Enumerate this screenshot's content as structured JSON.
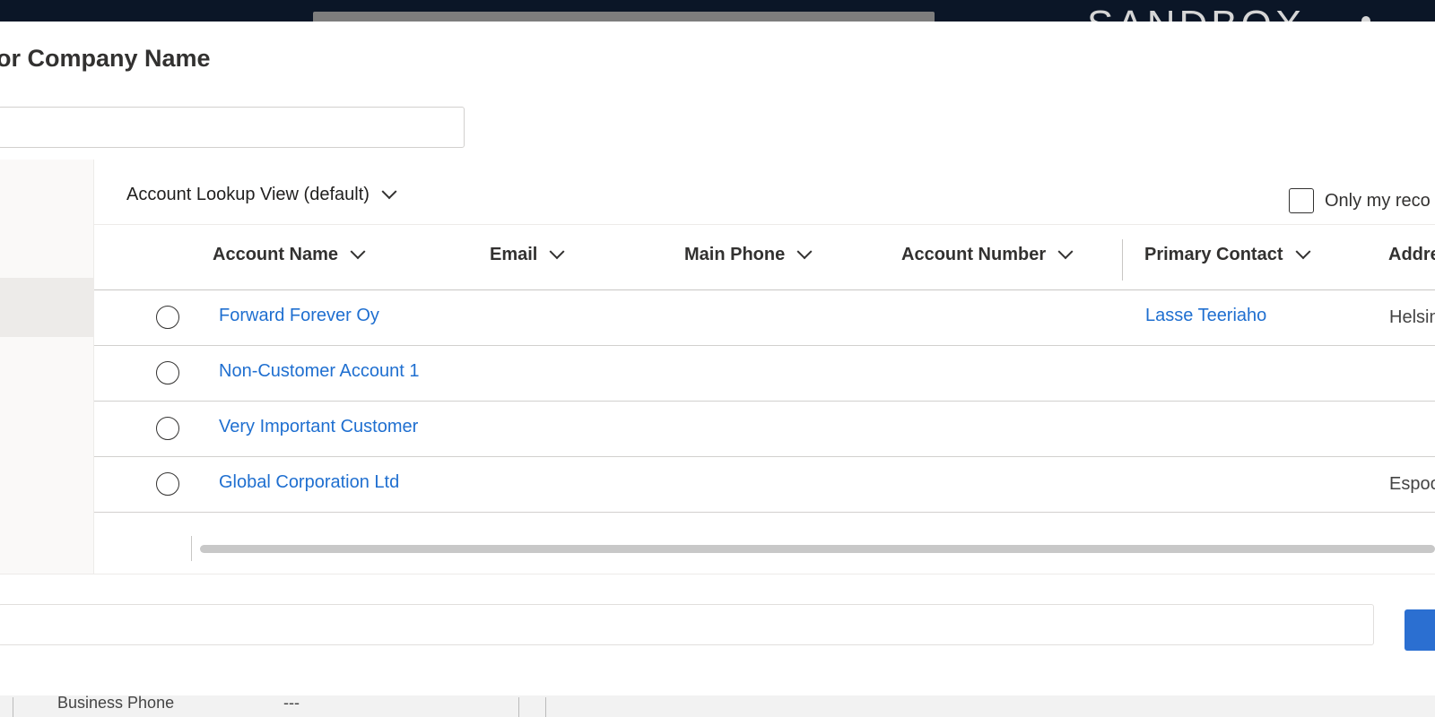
{
  "topbar": {
    "environment_label": "SANDBOX"
  },
  "background": {
    "field_label": "Business Phone",
    "field_value": "---"
  },
  "dialog": {
    "title": "or Company Name",
    "search": {
      "value": "",
      "placeholder": ""
    },
    "view_selector": {
      "label": "Account Lookup View (default)"
    },
    "only_my_records": {
      "label": "Only my reco",
      "checked": false
    },
    "columns": [
      {
        "label": "Account Name"
      },
      {
        "label": "Email"
      },
      {
        "label": "Main Phone"
      },
      {
        "label": "Account Number"
      },
      {
        "label": "Primary Contact"
      },
      {
        "label": "Addre"
      }
    ],
    "rows": [
      {
        "account_name": "Forward Forever Oy",
        "primary_contact": "Lasse Teeriaho",
        "address": "Helsin"
      },
      {
        "account_name": "Non-Customer Account 1",
        "primary_contact": "",
        "address": ""
      },
      {
        "account_name": "Very Important Customer",
        "primary_contact": "",
        "address": ""
      },
      {
        "account_name": "Global Corporation Ltd",
        "primary_contact": "",
        "address": "Espoo"
      }
    ]
  },
  "colors": {
    "link": "#1f6fd0",
    "primary_button": "#2b6fd1",
    "topbar": "#0b1627"
  },
  "icons": [
    "chevron-down-icon",
    "radio-button-icon",
    "checkbox-icon"
  ]
}
